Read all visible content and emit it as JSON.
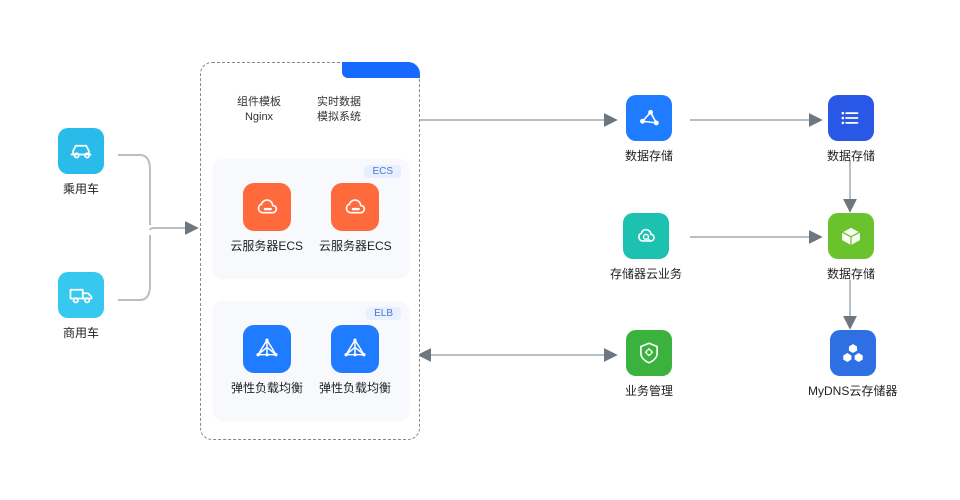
{
  "left": {
    "car": {
      "label": "乘用车"
    },
    "truck": {
      "label": "商用车"
    }
  },
  "cloud": {
    "top": {
      "col1_line1": "组件模板",
      "col1_line2": "Nginx",
      "col2_line1": "实时数据",
      "col2_line2": "模拟系统"
    },
    "ecs": {
      "tag": "ECS",
      "item1": "云服务器ECS",
      "item2": "云服务器ECS"
    },
    "elb": {
      "tag": "ELB",
      "item1": "弹性负载均衡",
      "item2": "弹性负载均衡"
    }
  },
  "right": {
    "row1_a": "数据存储",
    "row1_b": "数据存储",
    "row2_a": "存储器云业务",
    "row2_b": "数据存储",
    "row3_a": "业务管理",
    "row3_b": "MyDNS云存储器"
  }
}
